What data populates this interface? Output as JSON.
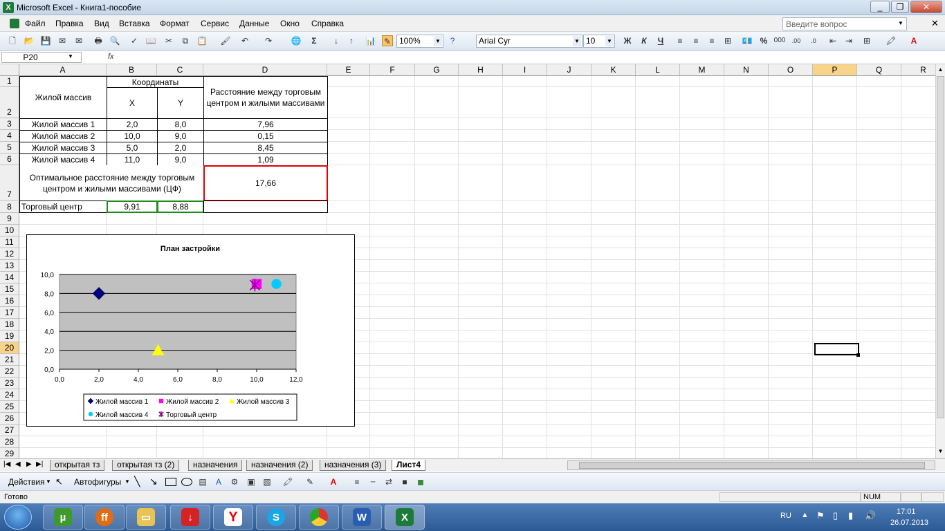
{
  "window": {
    "title": "Microsoft Excel - Книга1-пособие",
    "app_icon": "excel-icon",
    "minimize": "_",
    "restore": "❐",
    "close": "✕"
  },
  "menu": {
    "items": [
      "Файл",
      "Правка",
      "Вид",
      "Вставка",
      "Формат",
      "Сервис",
      "Данные",
      "Окно",
      "Справка"
    ],
    "help_placeholder": "Введите вопрос"
  },
  "toolbar": {
    "zoom": "100%",
    "font": "Arial Cyr",
    "font_size": "10",
    "bold": "Ж",
    "italic": "К",
    "underline": "Ч",
    "percent": "%",
    "thousands": "000"
  },
  "formula_bar": {
    "name_box": "P20",
    "fx": "fx",
    "content": ""
  },
  "columns": [
    "A",
    "B",
    "C",
    "D",
    "E",
    "F",
    "G",
    "H",
    "I",
    "J",
    "K",
    "L",
    "M",
    "N",
    "O",
    "P",
    "Q",
    "R"
  ],
  "rows": [
    "1",
    "2",
    "3",
    "4",
    "5",
    "6",
    "7",
    "8",
    "9",
    "10",
    "11",
    "12",
    "13",
    "14",
    "15",
    "16",
    "17",
    "18",
    "19",
    "20",
    "21",
    "22",
    "23",
    "24",
    "25",
    "26",
    "27",
    "28",
    "29"
  ],
  "selected": {
    "col": "P",
    "row": "20"
  },
  "table": {
    "header_a": "Жилой массив",
    "header_bc": "Координаты",
    "header_b": "X",
    "header_c": "Y",
    "header_d": "Расстояние между торговым центром и жилыми массивами",
    "rows": [
      {
        "name": "Жилой массив 1",
        "x": "2,0",
        "y": "8,0",
        "d": "7,96"
      },
      {
        "name": "Жилой массив 2",
        "x": "10,0",
        "y": "9,0",
        "d": "0,15"
      },
      {
        "name": "Жилой массив 3",
        "x": "5,0",
        "y": "2,0",
        "d": "8,45"
      },
      {
        "name": "Жилой массив 4",
        "x": "11,0",
        "y": "9,0",
        "d": "1,09"
      }
    ],
    "optimal_label": "Оптимальное расстояние между торговым центром и жилыми массивами (ЦФ)",
    "optimal_value": "17,66",
    "center_label": "Торговый центр",
    "center_x": "9,91",
    "center_y": "8,88"
  },
  "chart_data": {
    "type": "scatter",
    "title": "План застройки",
    "xlim": [
      0,
      12
    ],
    "ylim": [
      0,
      10
    ],
    "x_ticks": [
      "0,0",
      "2,0",
      "4,0",
      "6,0",
      "8,0",
      "10,0",
      "12,0"
    ],
    "y_ticks": [
      "0,0",
      "2,0",
      "4,0",
      "6,0",
      "8,0",
      "10,0"
    ],
    "grid": true,
    "legend_position": "bottom",
    "series": [
      {
        "name": "Жилой массив 1",
        "x": [
          2.0
        ],
        "y": [
          8.0
        ],
        "marker": "diamond",
        "color": "#000080"
      },
      {
        "name": "Жилой массив 2",
        "x": [
          10.0
        ],
        "y": [
          9.0
        ],
        "marker": "square",
        "color": "#ff00ff"
      },
      {
        "name": "Жилой массив 3",
        "x": [
          5.0
        ],
        "y": [
          2.0
        ],
        "marker": "triangle",
        "color": "#ffff00"
      },
      {
        "name": "Жилой массив 4",
        "x": [
          11.0
        ],
        "y": [
          9.0
        ],
        "marker": "circle",
        "color": "#00ccff"
      },
      {
        "name": "Торговый центр",
        "x": [
          9.91
        ],
        "y": [
          8.88
        ],
        "marker": "star",
        "color": "#800080"
      }
    ]
  },
  "sheet_tabs": {
    "items": [
      "открытая тз",
      "открытая тз (2)",
      "назначения",
      "назначения (2)",
      "назначения (3)",
      "Лист4"
    ],
    "active": "Лист4"
  },
  "drawing": {
    "actions": "Действия",
    "autoshapes": "Автофигуры"
  },
  "status": {
    "text": "Готово",
    "num": "NUM"
  },
  "taskbar": {
    "lang": "RU",
    "time": "17:01",
    "date": "26.07.2013"
  }
}
